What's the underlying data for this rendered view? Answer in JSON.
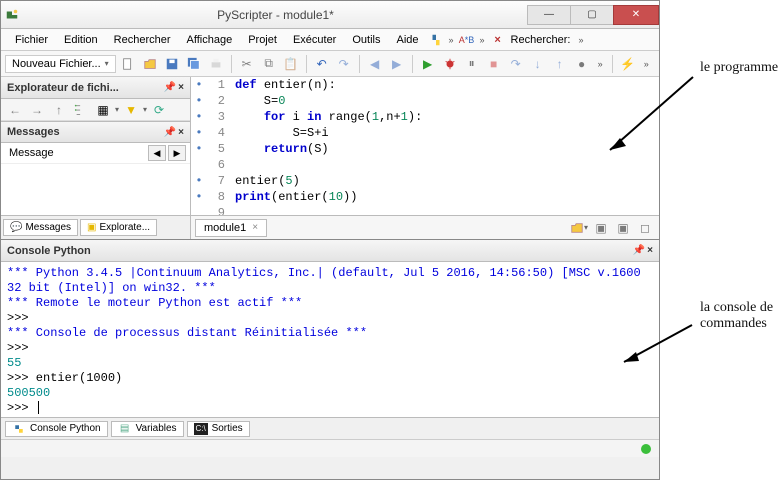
{
  "title": "PyScripter - module1*",
  "menus": [
    "Fichier",
    "Edition",
    "Rechercher",
    "Affichage",
    "Projet",
    "Exécuter",
    "Outils",
    "Aide"
  ],
  "search_label": "Rechercher:",
  "toolbar": {
    "new_file_label": "Nouveau Fichier..."
  },
  "explorer": {
    "title": "Explorateur de fichi..."
  },
  "messages": {
    "title": "Messages",
    "col": "Message"
  },
  "left_tabs": {
    "messages": "Messages",
    "explorer": "Explorate..."
  },
  "editor_tab": "module1",
  "code_lines": [
    {
      "n": 1,
      "dot": true,
      "segs": [
        {
          "t": "def ",
          "c": "kw"
        },
        {
          "t": "entier",
          "c": "fn"
        },
        {
          "t": "(n):",
          "c": "op"
        }
      ]
    },
    {
      "n": 2,
      "dot": true,
      "segs": [
        {
          "t": "    S=",
          "c": "op"
        },
        {
          "t": "0",
          "c": "num"
        }
      ]
    },
    {
      "n": 3,
      "dot": true,
      "segs": [
        {
          "t": "    ",
          "c": "op"
        },
        {
          "t": "for ",
          "c": "kw"
        },
        {
          "t": "i ",
          "c": "op"
        },
        {
          "t": "in ",
          "c": "kw"
        },
        {
          "t": "range",
          "c": "call"
        },
        {
          "t": "(",
          "c": "op"
        },
        {
          "t": "1",
          "c": "num"
        },
        {
          "t": ",n+",
          "c": "op"
        },
        {
          "t": "1",
          "c": "num"
        },
        {
          "t": "):",
          "c": "op"
        }
      ]
    },
    {
      "n": 4,
      "dot": true,
      "segs": [
        {
          "t": "        S=S+i",
          "c": "op"
        }
      ]
    },
    {
      "n": 5,
      "dot": true,
      "segs": [
        {
          "t": "    ",
          "c": "op"
        },
        {
          "t": "return",
          "c": "kw"
        },
        {
          "t": "(S)",
          "c": "op"
        }
      ]
    },
    {
      "n": 6,
      "dot": false,
      "segs": []
    },
    {
      "n": 7,
      "dot": true,
      "segs": [
        {
          "t": "entier(",
          "c": "op"
        },
        {
          "t": "5",
          "c": "num"
        },
        {
          "t": ")",
          "c": "op"
        }
      ]
    },
    {
      "n": 8,
      "dot": true,
      "segs": [
        {
          "t": "print",
          "c": "kw"
        },
        {
          "t": "(entier(",
          "c": "op"
        },
        {
          "t": "10",
          "c": "num"
        },
        {
          "t": "))",
          "c": "op"
        }
      ]
    },
    {
      "n": 9,
      "dot": false,
      "segs": []
    }
  ],
  "console": {
    "title": "Console Python",
    "lines": [
      {
        "c": "c-blue",
        "t": "*** Python 3.4.5 |Continuum Analytics, Inc.| (default, Jul  5 2016, 14:56:50) [MSC v.1600 32 bit (Intel)] on win32. ***"
      },
      {
        "c": "c-blue",
        "t": "*** Remote le moteur Python  est actif ***"
      },
      {
        "c": "c-black",
        "t": ">>> "
      },
      {
        "c": "c-blue",
        "t": "*** Console de processus distant Réinitialisée ***"
      },
      {
        "c": "c-black",
        "t": ">>> "
      },
      {
        "c": "c-teal",
        "t": "55"
      },
      {
        "c": "c-black",
        "t": ">>> entier(1000)"
      },
      {
        "c": "c-teal",
        "t": "500500"
      },
      {
        "c": "c-black",
        "t": ">>> ",
        "cursor": true
      }
    ]
  },
  "out_tabs": {
    "console": "Console Python",
    "vars": "Variables",
    "output": "Sorties"
  },
  "annotations": {
    "top": "le programme",
    "bottom_l1": "la console de",
    "bottom_l2": "commandes"
  },
  "colors": {
    "run_green": "#2e9e2e",
    "close_red": "#c94f4f"
  }
}
